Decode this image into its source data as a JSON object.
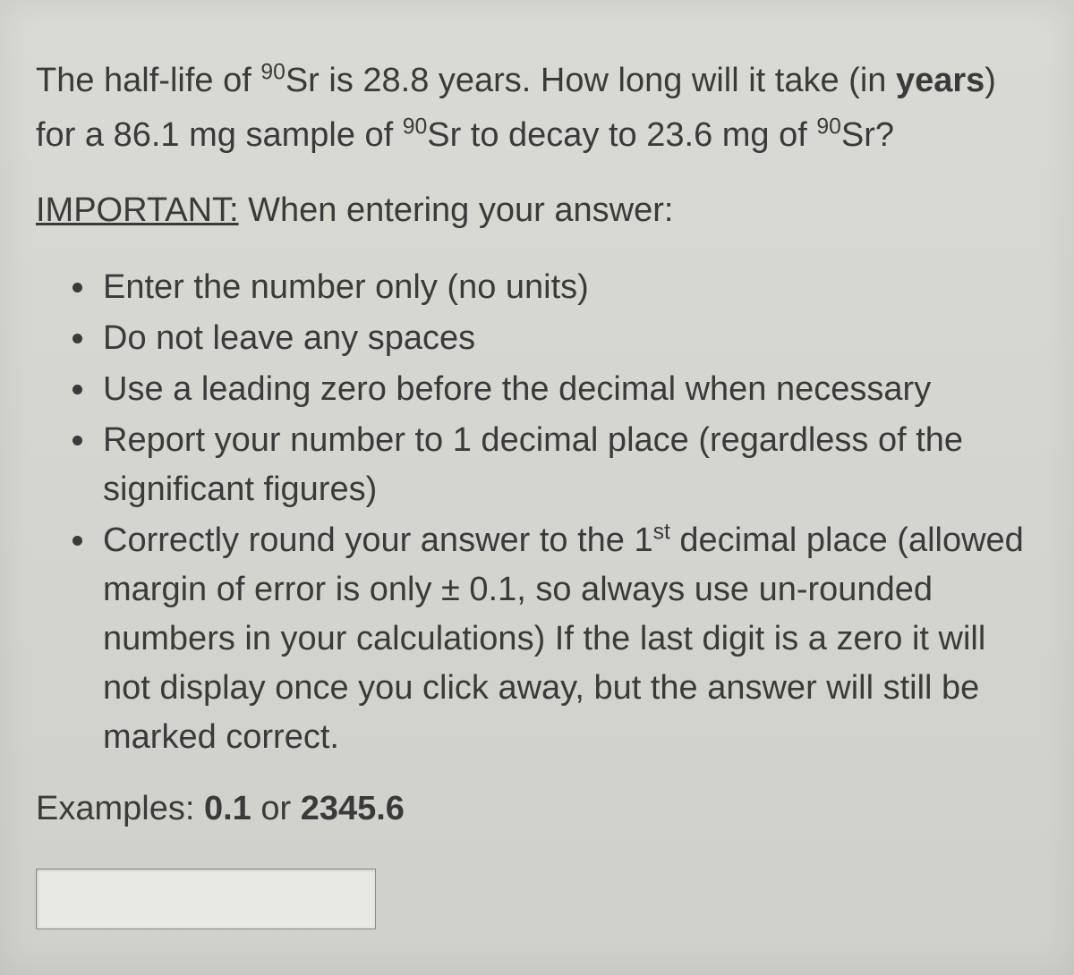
{
  "question": {
    "part1": "The half-life of ",
    "sup1": "90",
    "part2": "Sr is 28.8 years.  How long will it take (in ",
    "bold_years": "years",
    "part3": ") for a 86.1 mg sample of ",
    "sup2": "90",
    "part4": "Sr to decay to 23.6 mg of ",
    "sup3": "90",
    "part5": "Sr?"
  },
  "important": {
    "label": "IMPORTANT:",
    "rest": " When entering your answer:"
  },
  "rules": [
    {
      "text": "Enter the number only (no units)"
    },
    {
      "text": "Do not leave any spaces"
    },
    {
      "text": "Use a leading zero before the decimal when necessary"
    },
    {
      "text": "Report your number to 1 decimal place (regardless of the significant figures)"
    },
    {
      "pre": "Correctly round your answer to the 1",
      "sup": "st",
      "post": " decimal place (allowed margin of error is only ± 0.1, so always use un-rounded numbers in your calculations) If the last digit is a zero it will not display once you click away, but the answer will still be marked correct."
    }
  ],
  "examples": {
    "label": "Examples:  ",
    "val1": "0.1",
    "or": "  or  ",
    "val2": "2345.6"
  },
  "input": {
    "value": ""
  }
}
